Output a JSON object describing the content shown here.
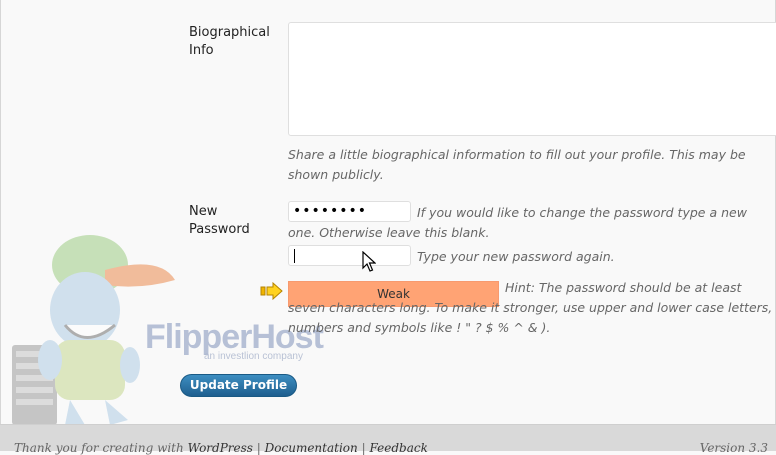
{
  "profile": {
    "bio_label": "Biographical Info",
    "bio_value": "",
    "bio_help": "Share a little biographical information to fill out your profile. This may be shown publicly.",
    "new_password_label": "New Password",
    "password_value": "••••••••",
    "password_help": "If you would like to change the password type a new one. Otherwise leave this blank.",
    "password_confirm_value": "",
    "password_confirm_help": "Type your new password again.",
    "strength_label": "Weak",
    "strength_color": "#ffa374",
    "hint": "Hint: The password should be at least seven characters long. To make it stronger, use upper and lower case letters, numbers and symbols like ! \" ? $ % ^ & ).",
    "update_button": "Update Profile"
  },
  "watermark": {
    "brand": "FlipperHost",
    "tagline": "an investlion company"
  },
  "footer": {
    "thanks_prefix": "Thank you for creating with",
    "wordpress_link": "WordPress",
    "sep": "|",
    "documentation_link": "Documentation",
    "feedback_link": "Feedback",
    "version": "Version 3.3"
  },
  "icons": {
    "arrow": "arrow-right-icon",
    "cursor": "mouse-pointer-icon"
  }
}
